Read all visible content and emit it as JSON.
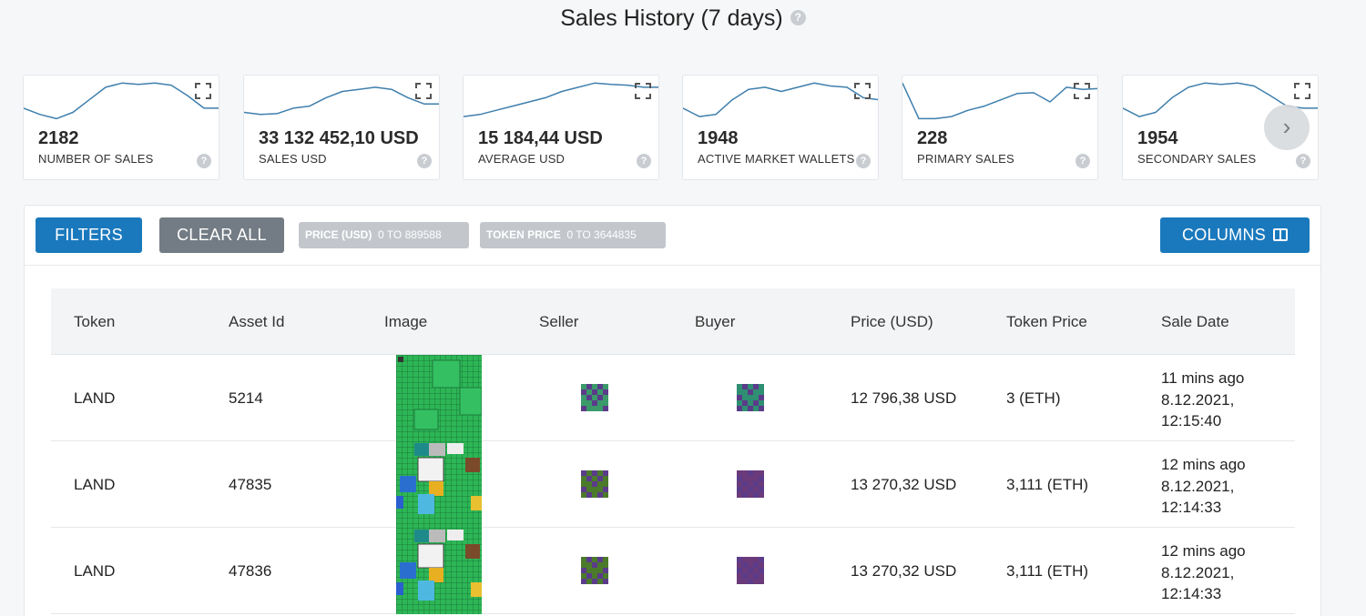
{
  "title": "Sales History (7 days)",
  "help_glyph": "?",
  "stats": [
    {
      "value": "2182",
      "label": "NUMBER OF SALES",
      "trend": [
        0.35,
        0.2,
        0.1,
        0.25,
        0.55,
        0.85,
        0.95,
        0.92,
        0.95,
        0.9,
        0.65,
        0.35,
        0.35
      ]
    },
    {
      "value": "33 132 452,10 USD",
      "label": "SALES USD",
      "trend": [
        0.25,
        0.2,
        0.22,
        0.35,
        0.4,
        0.6,
        0.75,
        0.8,
        0.85,
        0.8,
        0.6,
        0.45,
        0.45
      ]
    },
    {
      "value": "15 184,44 USD",
      "label": "AVERAGE USD",
      "trend": [
        0.15,
        0.2,
        0.3,
        0.4,
        0.5,
        0.6,
        0.75,
        0.85,
        0.95,
        0.92,
        0.9,
        0.85,
        0.85
      ]
    },
    {
      "value": "1948",
      "label": "ACTIVE MARKET WALLETS",
      "trend": [
        0.35,
        0.15,
        0.2,
        0.55,
        0.8,
        0.85,
        0.75,
        0.85,
        0.95,
        0.88,
        0.85,
        0.6,
        0.55
      ]
    },
    {
      "value": "228",
      "label": "PRIMARY SALES",
      "trend": [
        0.95,
        0.1,
        0.1,
        0.15,
        0.3,
        0.4,
        0.55,
        0.7,
        0.72,
        0.5,
        0.85,
        0.8,
        0.82
      ]
    },
    {
      "value": "1954",
      "label": "SECONDARY SALES",
      "trend": [
        0.35,
        0.15,
        0.25,
        0.6,
        0.85,
        0.95,
        0.92,
        0.95,
        0.88,
        0.65,
        0.4,
        0.35,
        0.35
      ]
    }
  ],
  "next_glyph": "›",
  "toolbar": {
    "filters": "FILTERS",
    "clear_all": "CLEAR ALL",
    "columns": "COLUMNS",
    "chips": [
      {
        "name": "PRICE (USD)",
        "range": "0 TO 889588"
      },
      {
        "name": "TOKEN PRICE",
        "range": "0 TO 3644835"
      }
    ]
  },
  "table": {
    "headers": [
      "Token",
      "Asset Id",
      "Image",
      "Seller",
      "Buyer",
      "Price (USD)",
      "Token Price",
      "Sale Date"
    ],
    "rows": [
      {
        "token": "LAND",
        "asset_id": "5214",
        "price_usd": "12 796,38 USD",
        "token_price": "3 (ETH)",
        "ago": "11 mins ago",
        "date": "8.12.2021,",
        "time": "12:15:40",
        "seller_avatar": "#3a9a6a",
        "buyer_avatar": "#2f8f72"
      },
      {
        "token": "LAND",
        "asset_id": "47835",
        "price_usd": "13 270,32 USD",
        "token_price": "3,111 (ETH)",
        "ago": "12 mins ago",
        "date": "8.12.2021,",
        "time": "12:14:33",
        "seller_avatar": "#4a7a2a",
        "buyer_avatar": "#6a3a7a"
      },
      {
        "token": "LAND",
        "asset_id": "47836",
        "price_usd": "13 270,32 USD",
        "token_price": "3,111 (ETH)",
        "ago": "12 mins ago",
        "date": "8.12.2021,",
        "time": "12:14:33",
        "seller_avatar": "#4a7a2a",
        "buyer_avatar": "#6a3a7a"
      }
    ]
  },
  "colors": {
    "primary": "#1a79bd",
    "secondary": "#737c84",
    "chip": "#c3c7cc",
    "spark": "#3f7fad",
    "land_green": "#2db656"
  }
}
